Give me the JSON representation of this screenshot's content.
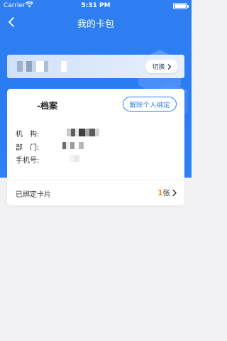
{
  "status_bar": {
    "carrier": "Carrier",
    "time": "5:31 PM"
  },
  "nav": {
    "title": "我的卡包"
  },
  "org_bar": {
    "org_name": "",
    "switch_label": "切换"
  },
  "card": {
    "name": "-档案",
    "unbind_label": "解除个人绑定",
    "fields": [
      {
        "label": "机　构:",
        "value": ""
      },
      {
        "label": "部　门:",
        "value": ""
      },
      {
        "label": "手机号:",
        "value": ""
      }
    ],
    "bound_cards_label": "已绑定卡片",
    "bound_count": "1",
    "bound_unit": "张"
  },
  "colors": {
    "primary": "#2f7ff2",
    "accent": "#f08a24",
    "background": "#f2f2f4"
  }
}
